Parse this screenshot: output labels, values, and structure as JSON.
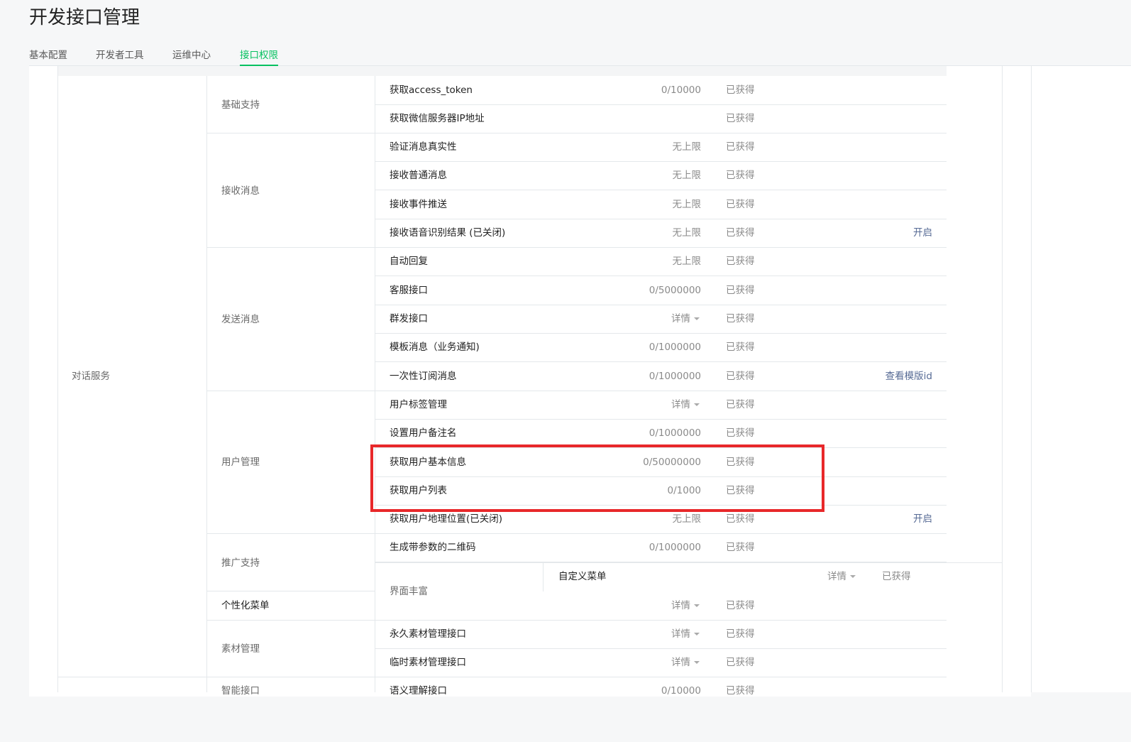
{
  "page": {
    "title": "开发接口管理"
  },
  "tabs": [
    {
      "label": "基本配置"
    },
    {
      "label": "开发者工具"
    },
    {
      "label": "运维中心"
    },
    {
      "label": "接口权限",
      "active": true
    }
  ],
  "table": {
    "category": "对话服务",
    "groups": [
      {
        "label": "基础支持"
      },
      {
        "label": "接收消息"
      },
      {
        "label": "发送消息"
      },
      {
        "label": "用户管理"
      },
      {
        "label": "推广支持"
      },
      {
        "label": "个性化菜单"
      },
      {
        "label": "素材管理"
      },
      {
        "label": "智能接口"
      },
      {
        "label": "界面丰富"
      }
    ],
    "rows": [
      {
        "name": "获取access_token",
        "quota": "0/10000",
        "status": "已获得",
        "action": ""
      },
      {
        "name": "获取微信服务器IP地址",
        "quota": "",
        "status": "已获得",
        "action": ""
      },
      {
        "name": "验证消息真实性",
        "quota": "无上限",
        "status": "已获得",
        "action": ""
      },
      {
        "name": "接收普通消息",
        "quota": "无上限",
        "status": "已获得",
        "action": ""
      },
      {
        "name": "接收事件推送",
        "quota": "无上限",
        "status": "已获得",
        "action": ""
      },
      {
        "name": "接收语音识别结果 (已关闭)",
        "quota": "无上限",
        "status": "已获得",
        "action": "开启"
      },
      {
        "name": "自动回复",
        "quota": "无上限",
        "status": "已获得",
        "action": ""
      },
      {
        "name": "客服接口",
        "quota": "0/5000000",
        "status": "已获得",
        "action": ""
      },
      {
        "name": "群发接口",
        "quota": "详情",
        "status": "已获得",
        "action": ""
      },
      {
        "name": "模板消息（业务通知)",
        "quota": "0/1000000",
        "status": "已获得",
        "action": ""
      },
      {
        "name": "一次性订阅消息",
        "quota": "0/1000000",
        "status": "已获得",
        "action": "查看模版id"
      },
      {
        "name": "用户标签管理",
        "quota": "详情",
        "status": "已获得",
        "action": ""
      },
      {
        "name": "设置用户备注名",
        "quota": "0/1000000",
        "status": "已获得",
        "action": ""
      },
      {
        "name": "获取用户基本信息",
        "quota": "0/50000000",
        "status": "已获得",
        "action": ""
      },
      {
        "name": "获取用户列表",
        "quota": "0/1000",
        "status": "已获得",
        "action": ""
      },
      {
        "name": "获取用户地理位置(已关闭)",
        "quota": "无上限",
        "status": "已获得",
        "action": "开启"
      },
      {
        "name": "生成带参数的二维码",
        "quota": "0/1000000",
        "status": "已获得",
        "action": ""
      },
      {
        "name": "自定义菜单",
        "quota": "详情",
        "status": "已获得",
        "action": ""
      },
      {
        "name": "",
        "quota": "详情",
        "status": "已获得",
        "action": ""
      },
      {
        "name": "永久素材管理接口",
        "quota": "详情",
        "status": "已获得",
        "action": ""
      },
      {
        "name": "临时素材管理接口",
        "quota": "详情",
        "status": "已获得",
        "action": ""
      },
      {
        "name": "语义理解接口",
        "quota": "0/10000",
        "status": "已获得",
        "action": ""
      }
    ]
  }
}
